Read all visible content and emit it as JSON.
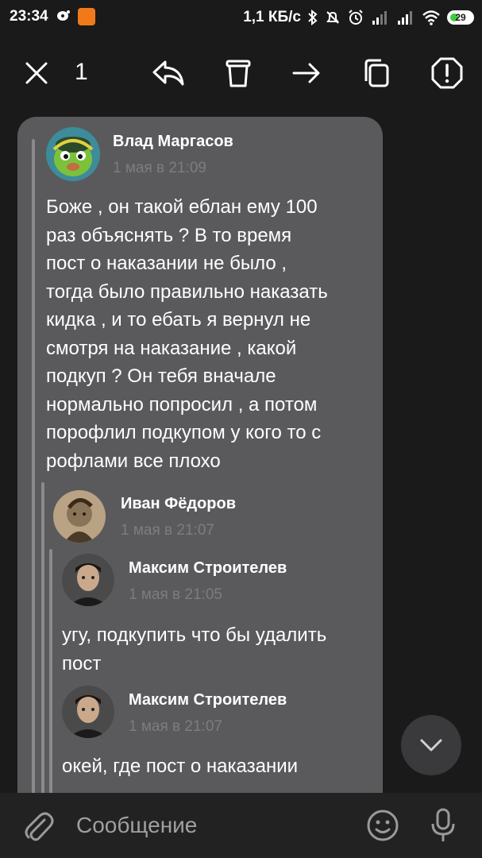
{
  "status_bar": {
    "time": "23:34",
    "net_speed": "1,1 КБ/с",
    "battery": "29"
  },
  "toolbar": {
    "selected_count": "1",
    "icons": [
      "close-icon",
      "reply-icon",
      "trash-icon",
      "forward-icon",
      "copy-icon",
      "report-icon"
    ]
  },
  "post": {
    "author": "Влад Маргасов",
    "date": "1 мая в 21:09",
    "text": "Боже , он такой еблан ему 100\nраз объяснять ?  В то время\nпост о наказании не было ,\nтогда было правильно наказать\nкидка , и то ебать я вернул не\nсмотря на наказание , какой\nподкуп ? Он тебя вначале\nнормально попросил , а потом\nпорофлил подкупом у кого то с\nрофлами все плохо"
  },
  "quote1": {
    "author": "Иван Фёдоров",
    "date": "1 мая в 21:07"
  },
  "quote2": {
    "author": "Максим Строителев",
    "date": "1 мая в 21:05",
    "text": "угу, подкупить что бы удалить\nпост"
  },
  "quote3": {
    "author": "Максим Строителев",
    "date": "1 мая в 21:07",
    "text": "окей, где пост о наказании"
  },
  "composer": {
    "placeholder": "Сообщение"
  },
  "colors": {
    "background": "#1a1a1a",
    "card": "#5a5a5c",
    "date_text": "#7d7d80",
    "battery_fill": "#3dcc3d",
    "app_badge": "#f07a1a"
  }
}
